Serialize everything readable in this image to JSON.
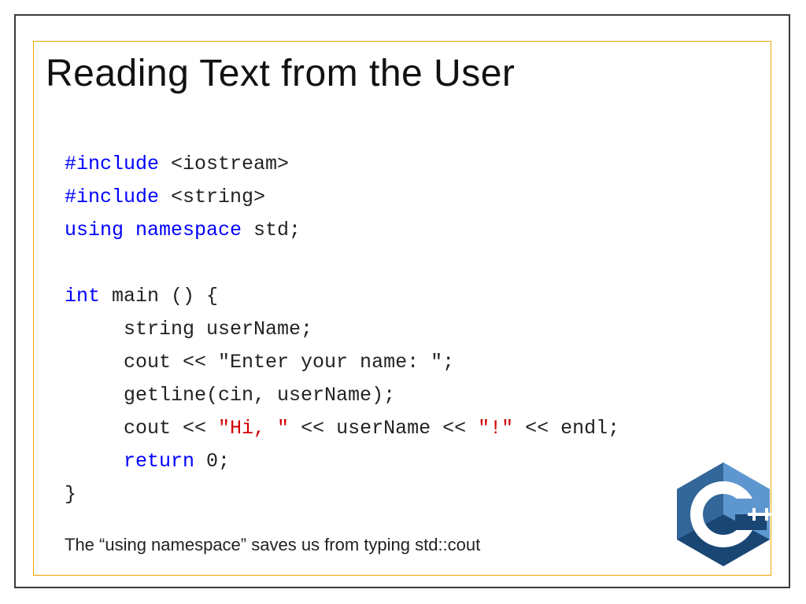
{
  "title": "Reading Text from the User",
  "code": {
    "l1_kw": "#include",
    "l1_rest": " <iostream>",
    "l2_kw": "#include",
    "l2_rest": " <string>",
    "l3_kw": "using namespace",
    "l3_rest": " std;",
    "l4": "",
    "l5_kw": "int",
    "l5_rest": " main () {",
    "l6": "     string userName;",
    "l7": "     cout << \"Enter your name: \";",
    "l8": "     getline(cin, userName);",
    "l9a": "     cout << ",
    "l9s1": "\"Hi, \"",
    "l9b": " << userName << ",
    "l9s2": "\"!\"",
    "l9c": " << endl;",
    "l10_kw": "     return",
    "l10_rest": " 0;",
    "l11": "}"
  },
  "footer": "The “using namespace” saves us from typing std::cout",
  "logo_name": "cpp-logo"
}
